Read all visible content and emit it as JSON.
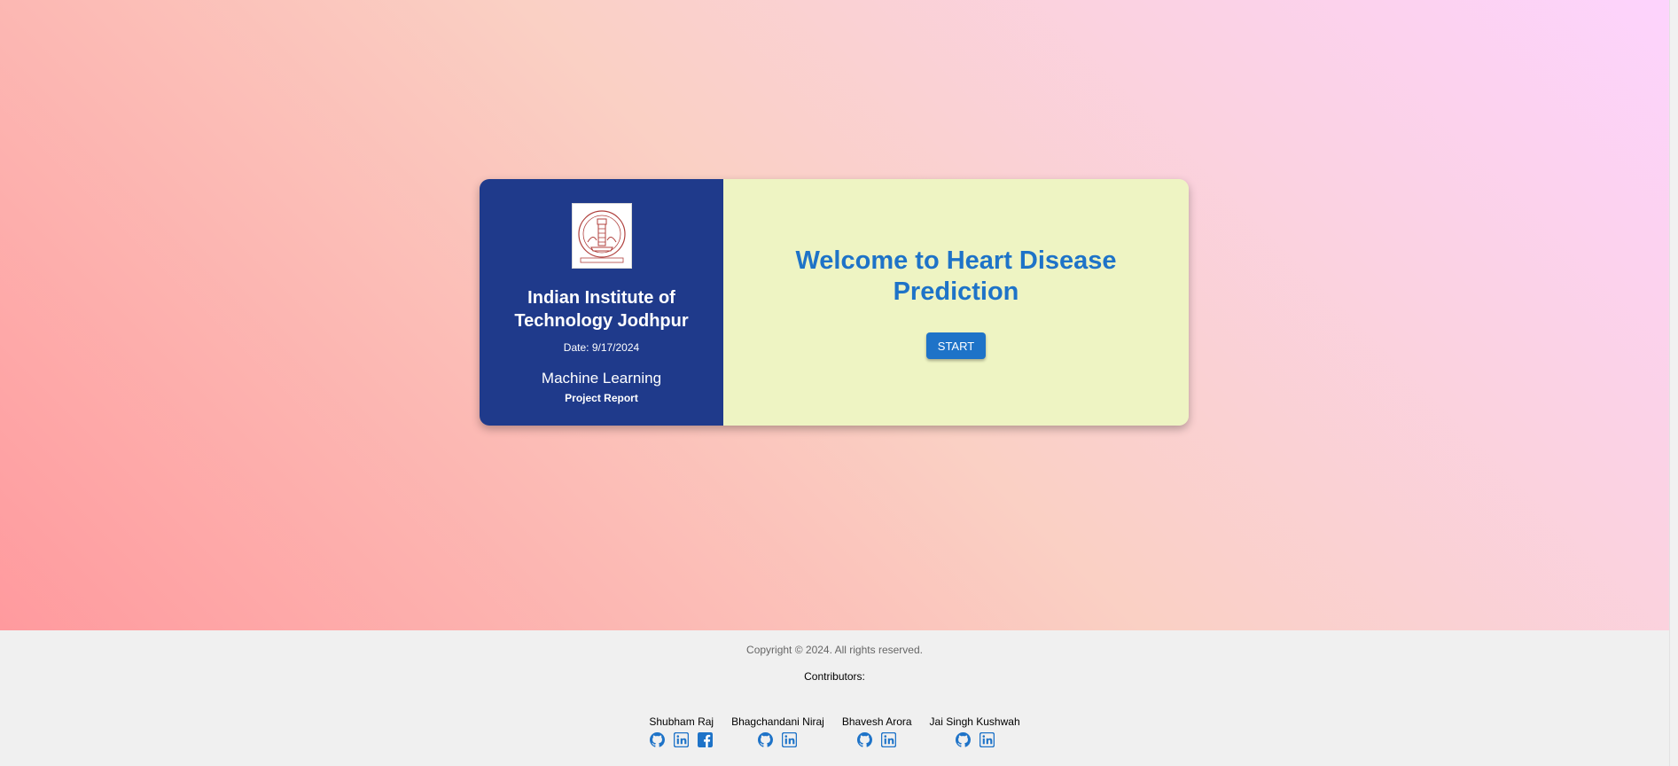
{
  "institute": {
    "name": "Indian Institute of Technology Jodhpur",
    "date": "Date: 9/17/2024",
    "course": "Machine Learning",
    "report": "Project Report",
    "logo_icon": "iit-jodhpur-emblem"
  },
  "welcome": {
    "title": "Welcome to Heart Disease Prediction",
    "start_label": "START"
  },
  "footer": {
    "copyright": "Copyright © 2024. All rights reserved.",
    "contributors_label": "Contributors:",
    "contributors": [
      {
        "name": "Shubham Raj",
        "links": [
          "github-icon",
          "linkedin-icon",
          "facebook-icon"
        ]
      },
      {
        "name": "Bhagchandani Niraj",
        "links": [
          "github-icon",
          "linkedin-icon"
        ]
      },
      {
        "name": "Bhavesh Arora",
        "links": [
          "github-icon",
          "linkedin-icon"
        ]
      },
      {
        "name": "Jai Singh Kushwah",
        "links": [
          "github-icon",
          "linkedin-icon"
        ]
      }
    ]
  },
  "colors": {
    "card_left_bg": "#1f3a8b",
    "card_right_bg": "#eef4c3",
    "accent": "#1e73c8",
    "footer_bg": "#f0f0f0"
  }
}
